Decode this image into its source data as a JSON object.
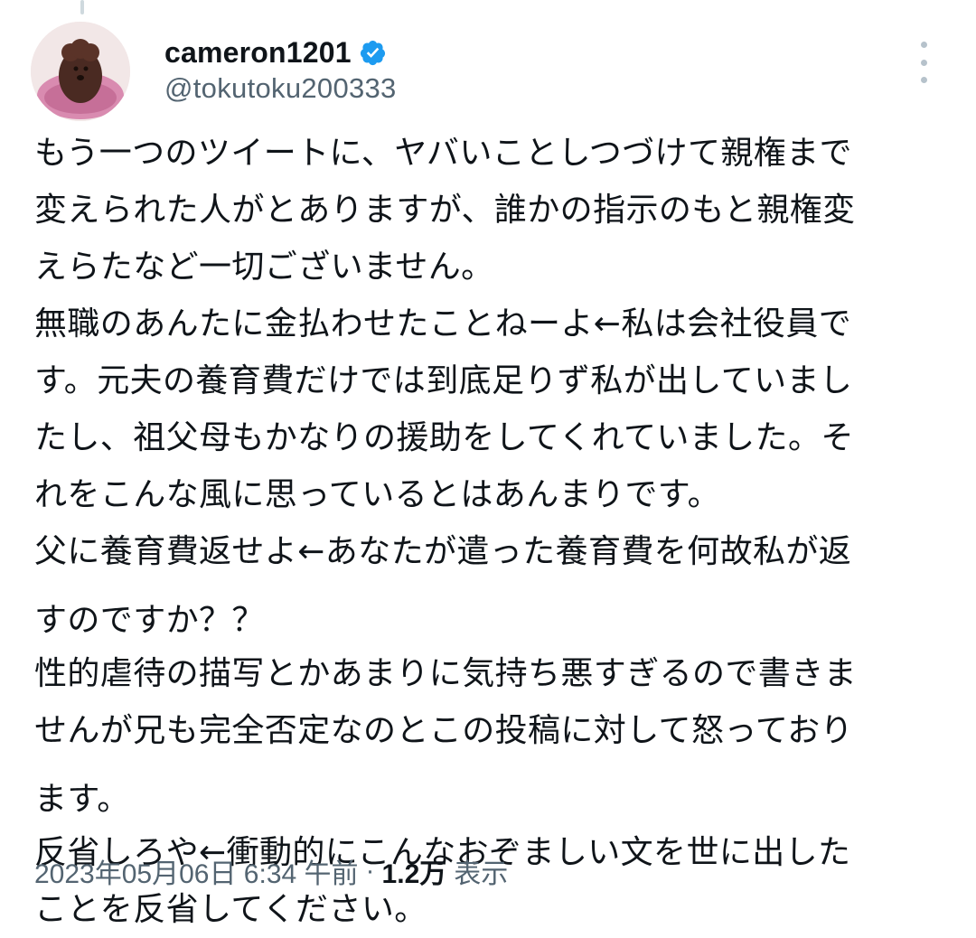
{
  "author": {
    "display_name": "cameron1201",
    "handle": "@tokutoku200333",
    "verified": true
  },
  "tweet": {
    "lines": [
      "もう一つのツイートに、ヤバいことしつづけて親権まで",
      "変えられた人がとありますが、誰かの指示のもと親権変",
      "えらたなど一切ございません。",
      "無職のあんたに金払わせたことねーよ←私は会社役員で",
      "す。元夫の養育費だけでは到底足りず私が出していまし",
      "たし、祖父母もかなりの援助をしてくれていました。そ",
      "れをこんな風に思っているとはあんまりです。",
      "父に養育費返せよ←あなたが遣った養育費を何故私が返",
      "すのですか？？",
      "性的虐待の描写とかあまりに気持ち悪すぎるので書きま",
      "せんが兄も完全否定なのとこの投稿に対して怒っており",
      "ます。",
      "反省しろや←衝動的にこんなおぞましい文を世に出した",
      "ことを反省してください。"
    ]
  },
  "meta": {
    "timestamp": "2023年05月06日 6:34 午前",
    "separator": "·",
    "views_count": "1.2万",
    "views_label": "表示"
  },
  "colors": {
    "text_primary": "#0f1419",
    "text_secondary": "#536471",
    "verified_badge": "#1d9bf0"
  }
}
